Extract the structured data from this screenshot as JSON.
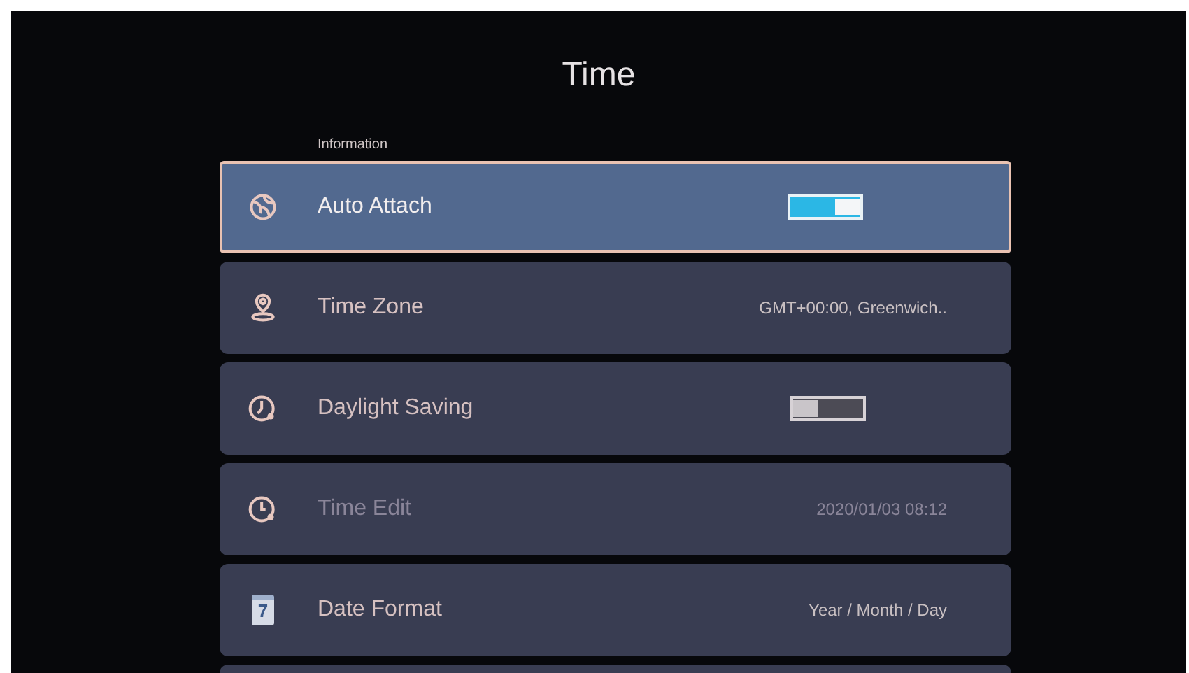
{
  "title": "Time",
  "section": "Information",
  "rows": [
    {
      "kind": "toggle",
      "label": "Auto Attach",
      "selected": true,
      "disabled": false,
      "on": true
    },
    {
      "kind": "value",
      "label": "Time Zone",
      "selected": false,
      "disabled": false,
      "value": "GMT+00:00, Greenwich.."
    },
    {
      "kind": "toggle",
      "label": "Daylight Saving",
      "selected": false,
      "disabled": false,
      "on": false
    },
    {
      "kind": "value",
      "label": "Time Edit",
      "selected": false,
      "disabled": true,
      "value": "2020/01/03 08:12"
    },
    {
      "kind": "value",
      "label": "Date Format",
      "selected": false,
      "disabled": false,
      "value": "Year / Month / Day",
      "icon_text": "7"
    }
  ]
}
